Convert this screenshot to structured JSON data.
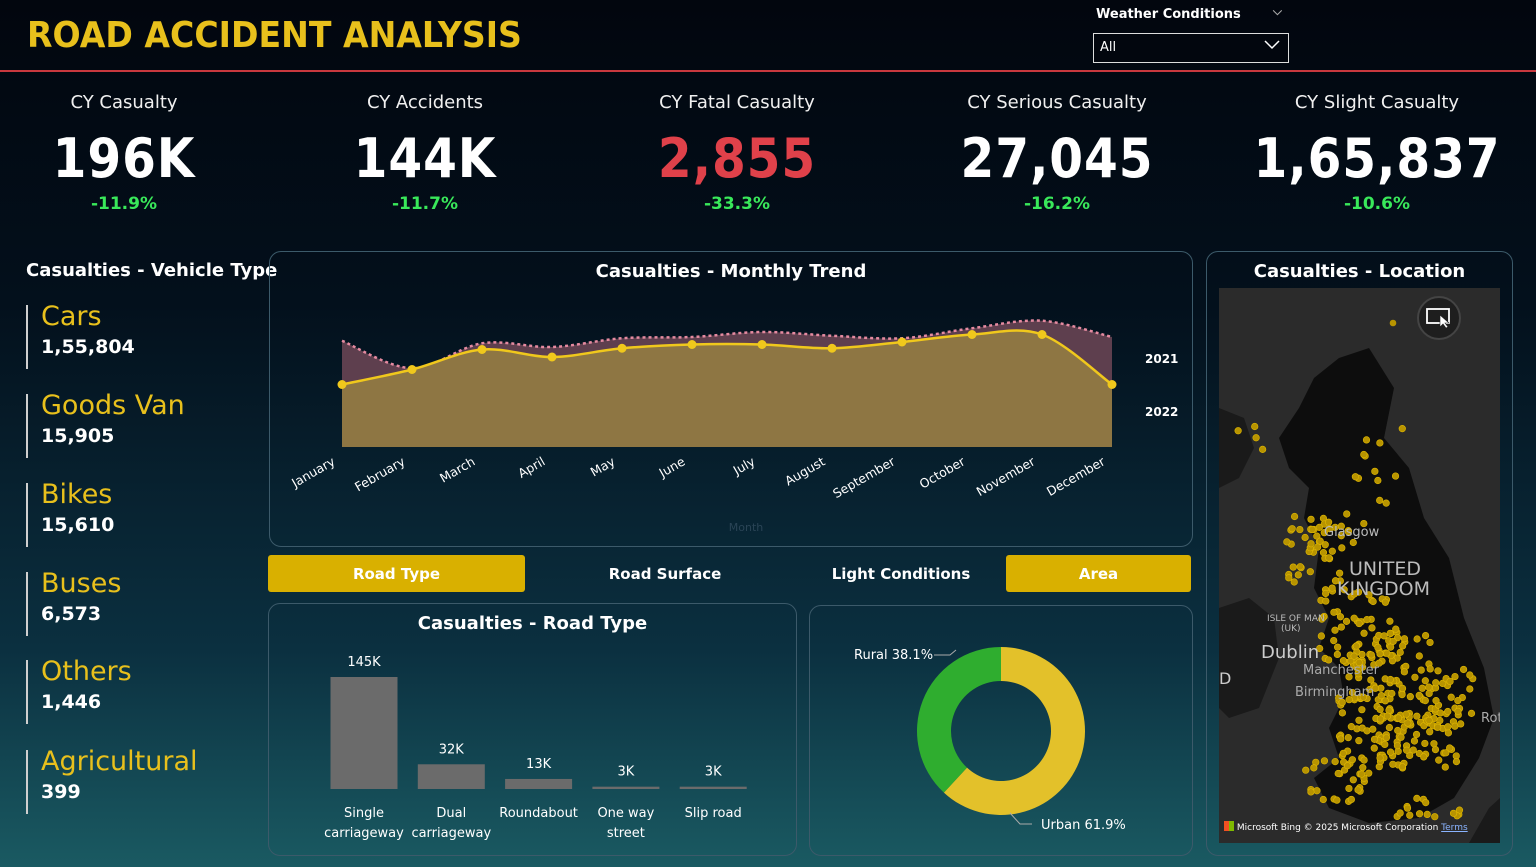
{
  "header": {
    "title": "ROAD ACCIDENT ANALYSIS",
    "filter_label": "Weather Conditions",
    "filter_value": "All"
  },
  "kpis": [
    {
      "label": "CY Casualty",
      "value": "196K",
      "delta": "-11.9%"
    },
    {
      "label": "CY Accidents",
      "value": "144K",
      "delta": "-11.7%"
    },
    {
      "label": "CY Fatal Casualty",
      "value": "2,855",
      "delta": "-33.3%"
    },
    {
      "label": "CY Serious Casualty",
      "value": "27,045",
      "delta": "-16.2%"
    },
    {
      "label": "CY Slight Casualty",
      "value": "1,65,837",
      "delta": "-10.6%"
    }
  ],
  "colors": {
    "accent": "#e8c01c",
    "fatal": "#e0414a",
    "positive": "#39e85a",
    "divider": "#c8383e",
    "green_slice": "#2fad2f"
  },
  "vehicle_type": {
    "title": "Casualties - Vehicle Type",
    "items": [
      {
        "name": "Cars",
        "value": "1,55,804"
      },
      {
        "name": "Goods Van",
        "value": "15,905"
      },
      {
        "name": "Bikes",
        "value": "15,610"
      },
      {
        "name": "Buses",
        "value": "6,573"
      },
      {
        "name": "Others",
        "value": "1,446"
      },
      {
        "name": "Agricultural",
        "value": "399"
      }
    ]
  },
  "tabs": [
    {
      "label": "Road Type",
      "active": true
    },
    {
      "label": "Road Surface",
      "active": false
    },
    {
      "label": "Light Conditions",
      "active": false
    },
    {
      "label": "Area",
      "active": true
    }
  ],
  "map": {
    "title": "Casualties - Location",
    "labels": [
      "Glasgow",
      "UNITED",
      "KINGDOM",
      "ISLE OF MAN",
      "(UK)",
      "Dublin",
      "Manchester",
      "Birmingham",
      "D",
      "Rot"
    ],
    "footer": "Microsoft Bing",
    "copyright": "© 2025 Microsoft Corporation",
    "terms": "Terms"
  },
  "chart_data": [
    {
      "type": "area",
      "title": "Casualties - Monthly Trend",
      "xlabel": "Month",
      "categories": [
        "January",
        "February",
        "March",
        "April",
        "May",
        "June",
        "July",
        "August",
        "September",
        "October",
        "November",
        "December"
      ],
      "series": [
        {
          "name": "2021",
          "values": [
            17500,
            15300,
            17300,
            17000,
            17700,
            17800,
            18200,
            17900,
            17700,
            18500,
            19100,
            17800
          ]
        },
        {
          "name": "2022",
          "values": [
            14000,
            15200,
            16800,
            16200,
            16900,
            17200,
            17200,
            16900,
            17400,
            18000,
            18000,
            14000
          ]
        }
      ],
      "ylim": [
        9000,
        21000
      ]
    },
    {
      "type": "bar",
      "title": "Casualties - Road Type",
      "categories": [
        "Single carriageway",
        "Dual carriageway",
        "Roundabout",
        "One way street",
        "Slip road"
      ],
      "category_lines": [
        [
          "Single",
          "carriageway"
        ],
        [
          "Dual",
          "carriageway"
        ],
        [
          "Roundabout"
        ],
        [
          "One way",
          "street"
        ],
        [
          "Slip road"
        ]
      ],
      "values": [
        145000,
        32000,
        13000,
        3000,
        3000
      ],
      "data_labels": [
        "145K",
        "32K",
        "13K",
        "3K",
        "3K"
      ]
    },
    {
      "type": "pie",
      "title": "",
      "categories": [
        "Urban",
        "Rural"
      ],
      "values": [
        61.9,
        38.1
      ],
      "labels": [
        "Urban 61.9%",
        "Rural 38.1%"
      ],
      "colors": [
        "#e3c12a",
        "#2fad2f"
      ]
    }
  ]
}
